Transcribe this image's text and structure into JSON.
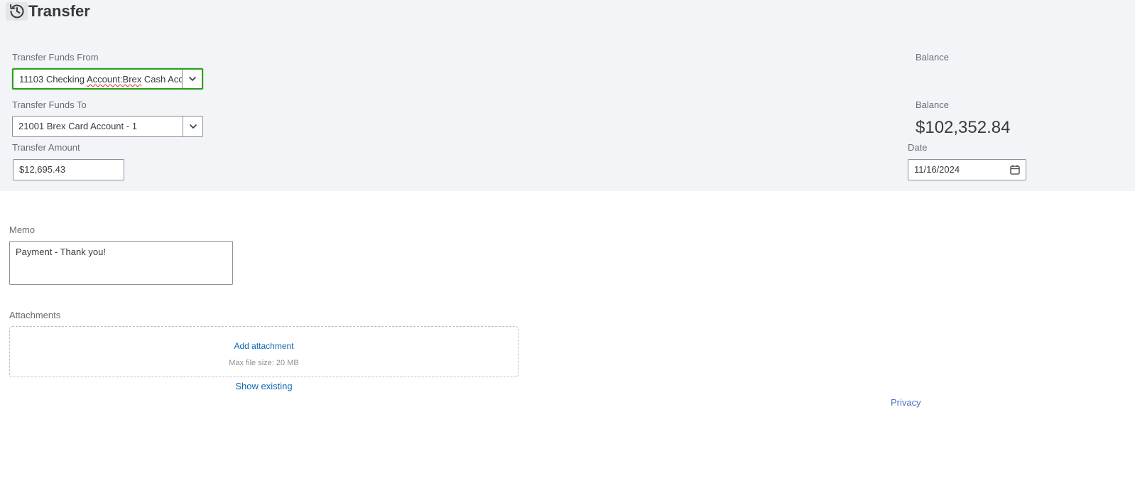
{
  "header": {
    "title": "Transfer",
    "history_icon": "history-clock-icon"
  },
  "transfer_from": {
    "label": "Transfer Funds From",
    "value_prefix": "11103 Checking ",
    "value_flagged": "Account:Brex",
    "value_suffix": " Cash Acc",
    "balance_label": "Balance",
    "balance_value": ""
  },
  "transfer_to": {
    "label": "Transfer Funds To",
    "value": "21001 Brex Card Account - 1",
    "balance_label": "Balance",
    "balance_value": "$102,352.84"
  },
  "amount": {
    "label": "Transfer Amount",
    "value": "$12,695.43"
  },
  "date": {
    "label": "Date",
    "value": "11/16/2024",
    "icon": "calendar-icon"
  },
  "memo": {
    "label": "Memo",
    "value": "Payment - Thank you!"
  },
  "attachments": {
    "label": "Attachments",
    "add_label": "Add attachment",
    "max_size": "Max file size: 20 MB",
    "show_existing": "Show existing"
  },
  "footer": {
    "privacy": "Privacy"
  },
  "colors": {
    "panel_bg": "#f3f4f8",
    "focus_green": "#2ca01c",
    "link_blue": "#0d67b5"
  }
}
